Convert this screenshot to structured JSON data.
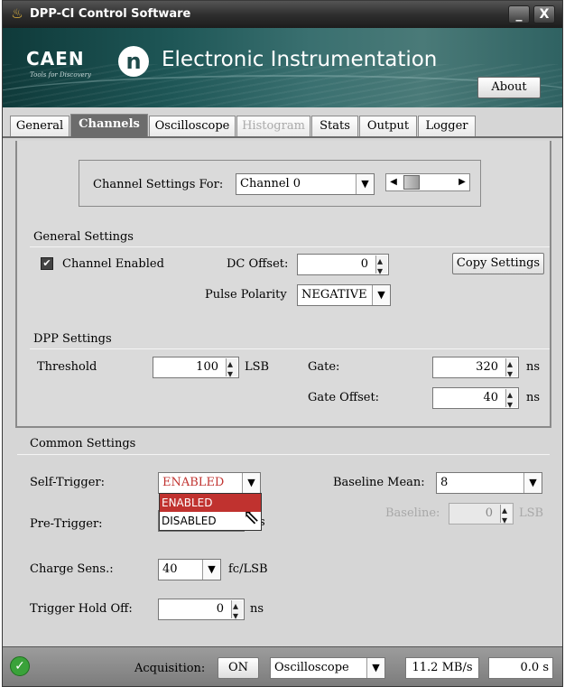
{
  "window": {
    "title": "DPP-CI Control Software",
    "minimize_glyph": "_",
    "close_glyph": "X"
  },
  "banner": {
    "brand": "CAEN",
    "brand_sub": "Tools for Discovery",
    "logo_glyph": "n",
    "title": "Electronic Instrumentation",
    "about_label": "About"
  },
  "tabs": [
    {
      "label": "General",
      "state": "normal"
    },
    {
      "label": "Channels",
      "state": "active"
    },
    {
      "label": "Oscilloscope",
      "state": "normal"
    },
    {
      "label": "Histogram",
      "state": "disabled"
    },
    {
      "label": "Stats",
      "state": "normal"
    },
    {
      "label": "Output",
      "state": "normal"
    },
    {
      "label": "Logger",
      "state": "normal"
    }
  ],
  "channel_select": {
    "label": "Channel Settings For:",
    "value": "Channel 0",
    "scroll_position": 0.0
  },
  "general_settings": {
    "title": "General Settings",
    "channel_enabled_label": "Channel Enabled",
    "channel_enabled": true,
    "dc_offset_label": "DC Offset:",
    "dc_offset_value": "0",
    "copy_settings_label": "Copy Settings",
    "pulse_polarity_label": "Pulse Polarity",
    "pulse_polarity_value": "NEGATIVE"
  },
  "dpp_settings": {
    "title": "DPP Settings",
    "threshold_label": "Threshold",
    "threshold_value": "100",
    "threshold_unit": "LSB",
    "gate_label": "Gate:",
    "gate_value": "320",
    "gate_unit": "ns",
    "gate_offset_label": "Gate Offset:",
    "gate_offset_value": "40",
    "gate_offset_unit": "ns"
  },
  "common_settings": {
    "title": "Common Settings",
    "self_trigger_label": "Self-Trigger:",
    "self_trigger_value": "ENABLED",
    "self_trigger_options": [
      "ENABLED",
      "DISABLED"
    ],
    "pre_trigger_label": "Pre-Trigger:",
    "pre_trigger_unit_partial": "s",
    "charge_sens_label": "Charge Sens.:",
    "charge_sens_value": "40",
    "charge_sens_unit": "fc/LSB",
    "trigger_hold_off_label": "Trigger Hold Off:",
    "trigger_hold_off_value": "0",
    "trigger_hold_off_unit": "ns",
    "baseline_mean_label": "Baseline Mean:",
    "baseline_mean_value": "8",
    "baseline_label": "Baseline:",
    "baseline_value": "0",
    "baseline_unit": "LSB"
  },
  "status_bar": {
    "ok_glyph": "✓",
    "acquisition_label": "Acquisition:",
    "acquisition_state": "ON",
    "mode_value": "Oscilloscope",
    "rate": "11.2 MB/s",
    "time": "0.0 s"
  },
  "colors": {
    "accent_selection": "#c0322f",
    "active_tab": "#6c6c6c",
    "status_ok": "#3aa23a"
  }
}
